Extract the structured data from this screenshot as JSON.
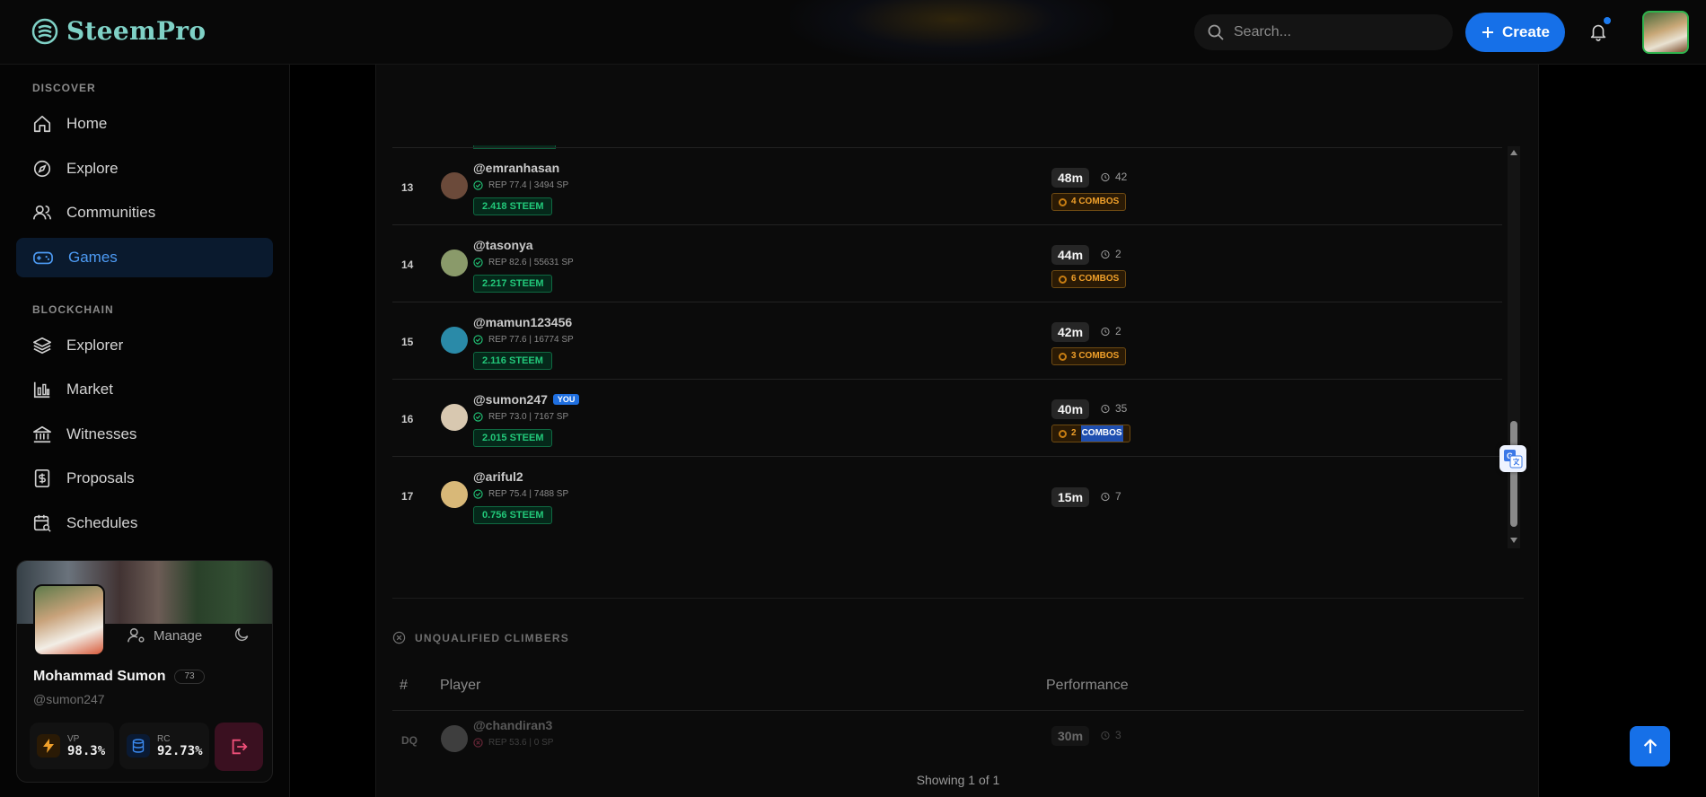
{
  "app": {
    "brand": "SteemPro"
  },
  "header": {
    "search_placeholder": "Search...",
    "create_label": "Create"
  },
  "sidebar": {
    "discover_label": "DISCOVER",
    "blockchain_label": "BLOCKCHAIN",
    "discover_items": [
      {
        "label": "Home",
        "icon": "home-icon"
      },
      {
        "label": "Explore",
        "icon": "compass-icon"
      },
      {
        "label": "Communities",
        "icon": "users-icon"
      },
      {
        "label": "Games",
        "icon": "gamepad-icon",
        "active": true
      }
    ],
    "blockchain_items": [
      {
        "label": "Explorer",
        "icon": "layers-icon"
      },
      {
        "label": "Market",
        "icon": "chart-icon"
      },
      {
        "label": "Witnesses",
        "icon": "bank-icon"
      },
      {
        "label": "Proposals",
        "icon": "dollar-doc-icon"
      },
      {
        "label": "Schedules",
        "icon": "calendar-search-icon"
      }
    ]
  },
  "profile": {
    "name": "Mohammad Sumon",
    "reputation": "73",
    "handle": "@sumon247",
    "manage_label": "Manage",
    "vp_label": "VP",
    "vp_value": "98.3%",
    "rc_label": "RC",
    "rc_value": "92.73%"
  },
  "leaderboard": {
    "rows": [
      {
        "rank": "13",
        "user": "@emranhasan",
        "meta": "REP 77.4 | 3494 SP",
        "steem": "2.418 STEEM",
        "time": "48m",
        "plays": "42",
        "combo": "4 COMBOS",
        "avatar_color": "#6b4a3a"
      },
      {
        "rank": "14",
        "user": "@tasonya",
        "meta": "REP 82.6 | 55631 SP",
        "steem": "2.217 STEEM",
        "time": "44m",
        "plays": "2",
        "combo": "6 COMBOS",
        "avatar_color": "#8a9a6a"
      },
      {
        "rank": "15",
        "user": "@mamun123456",
        "meta": "REP 77.6 | 16774 SP",
        "steem": "2.116 STEEM",
        "time": "42m",
        "plays": "2",
        "combo": "3 COMBOS",
        "avatar_color": "#2a8aa8"
      },
      {
        "rank": "16",
        "user": "@sumon247",
        "you": "YOU",
        "meta": "REP 73.0 | 7167 SP",
        "steem": "2.015 STEEM",
        "time": "40m",
        "plays": "35",
        "combo_count": "2",
        "combo_word": "COMBOS",
        "avatar_color": "#d8c8b0"
      },
      {
        "rank": "17",
        "user": "@ariful2",
        "meta": "REP 75.4 | 7488 SP",
        "steem": "0.756 STEEM",
        "time": "15m",
        "plays": "7",
        "avatar_color": "#d8b878"
      }
    ]
  },
  "unqualified": {
    "title": "UNQUALIFIED CLIMBERS",
    "col_rank": "#",
    "col_player": "Player",
    "col_performance": "Performance",
    "rows": [
      {
        "rank": "DQ",
        "user": "@chandiran3",
        "meta": "REP 53.6 | 0 SP",
        "time": "30m",
        "plays": "3"
      }
    ]
  },
  "pagination": {
    "text": "Showing 1 of 1"
  },
  "colors": {
    "accent": "#1670e8",
    "steem_green": "#22c97a",
    "combo_orange": "#f0a02a"
  }
}
